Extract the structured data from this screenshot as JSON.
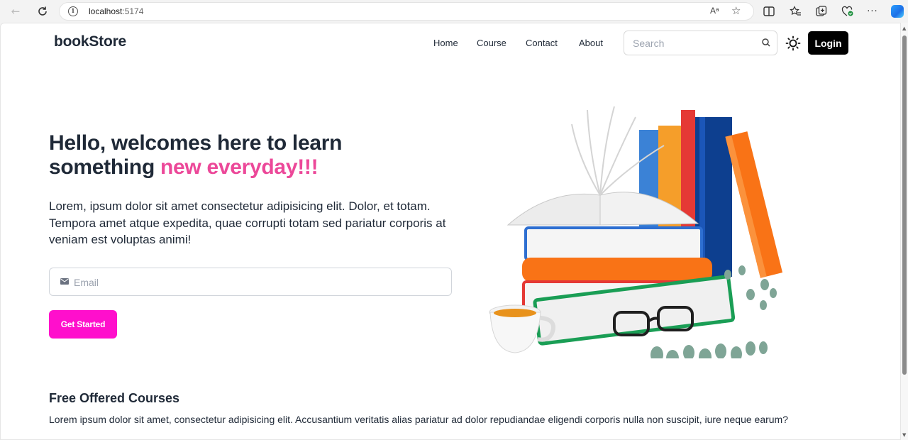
{
  "browser": {
    "url_host": "localhost",
    "url_port": ":5174",
    "read_aloud_label": "Aᵃ"
  },
  "navbar": {
    "logo": "bookStore",
    "menu": [
      "Home",
      "Course",
      "Contact",
      "About"
    ],
    "search_placeholder": "Search",
    "login_label": "Login"
  },
  "hero": {
    "title_main": "Hello, welcomes here to learn something ",
    "title_accent": "new everyday!!!",
    "description": "Lorem, ipsum dolor sit amet consectetur adipisicing elit. Dolor, et totam. Tempora amet atque expedita, quae corrupti totam sed pariatur corporis at veniam est voluptas animi!",
    "email_placeholder": "Email",
    "cta_label": "Get Started"
  },
  "courses": {
    "title": "Free Offered Courses",
    "description": "Lorem ipsum dolor sit amet, consectetur adipisicing elit. Accusantium veritatis alias pariatur ad dolor repudiandae eligendi corporis nulla non suscipit, iure neque earum?"
  },
  "colors": {
    "accent_pink": "#ec4899",
    "cta_magenta": "#ff0fcc",
    "login_bg": "#000000"
  }
}
